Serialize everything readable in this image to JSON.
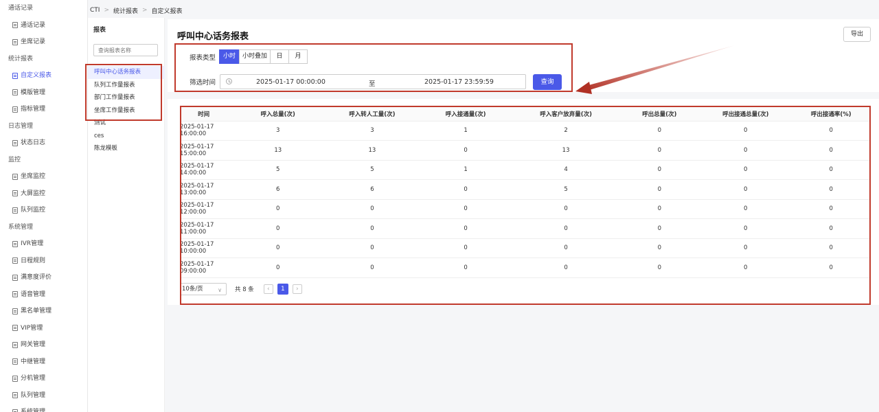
{
  "breadcrumb": [
    "CTI",
    "统计报表",
    "自定义报表"
  ],
  "sidebar": [
    {
      "type": "group",
      "label": "通话记录"
    },
    {
      "type": "item",
      "label": "通话记录"
    },
    {
      "type": "item",
      "label": "坐席记录"
    },
    {
      "type": "group",
      "label": "统计报表"
    },
    {
      "type": "item",
      "label": "自定义报表",
      "active": true
    },
    {
      "type": "item",
      "label": "模版管理"
    },
    {
      "type": "item",
      "label": "指标管理"
    },
    {
      "type": "group",
      "label": "日志管理"
    },
    {
      "type": "item",
      "label": "状态日志"
    },
    {
      "type": "group",
      "label": "监控"
    },
    {
      "type": "item",
      "label": "坐席监控"
    },
    {
      "type": "item",
      "label": "大屏监控"
    },
    {
      "type": "item",
      "label": "队列监控"
    },
    {
      "type": "group",
      "label": "系统管理"
    },
    {
      "type": "item",
      "label": "IVR管理"
    },
    {
      "type": "item",
      "label": "日程规则"
    },
    {
      "type": "item",
      "label": "满意度评价"
    },
    {
      "type": "item",
      "label": "语音管理"
    },
    {
      "type": "item",
      "label": "黑名单管理"
    },
    {
      "type": "item",
      "label": "VIP管理"
    },
    {
      "type": "item",
      "label": "网关管理"
    },
    {
      "type": "item",
      "label": "中继管理"
    },
    {
      "type": "item",
      "label": "分机管理"
    },
    {
      "type": "item",
      "label": "队列管理"
    },
    {
      "type": "item",
      "label": "系统管理"
    }
  ],
  "reports_panel": {
    "title": "报表",
    "search_placeholder": "查询报表名称",
    "items": [
      "呼叫中心话务报表",
      "队列工作量报表",
      "部门工作量报表",
      "坐席工作量报表",
      "测试",
      "ces",
      "陈龙模板"
    ],
    "active_index": 0
  },
  "main": {
    "title": "呼叫中心话务报表",
    "export_label": "导出",
    "filter": {
      "type_label": "报表类型",
      "types": [
        "小时",
        "小时叠加",
        "日",
        "月"
      ],
      "selected_type": "小时",
      "time_label": "筛选时间",
      "start": "2025-01-17 00:00:00",
      "to": "至",
      "end": "2025-01-17 23:59:59",
      "query_label": "查询"
    },
    "table": {
      "columns": [
        "时间",
        "呼入总量(次)",
        "呼入转人工量(次)",
        "呼入接通量(次)",
        "呼入客户放弃量(次)",
        "呼出总量(次)",
        "呼出接通总量(次)",
        "呼出接通率(%)"
      ],
      "rows": [
        [
          "2025-01-17 16:00:00",
          "3",
          "3",
          "1",
          "2",
          "0",
          "0",
          "0"
        ],
        [
          "2025-01-17 15:00:00",
          "13",
          "13",
          "0",
          "13",
          "0",
          "0",
          "0"
        ],
        [
          "2025-01-17 14:00:00",
          "5",
          "5",
          "1",
          "4",
          "0",
          "0",
          "0"
        ],
        [
          "2025-01-17 13:00:00",
          "6",
          "6",
          "0",
          "5",
          "0",
          "0",
          "0"
        ],
        [
          "2025-01-17 12:00:00",
          "0",
          "0",
          "0",
          "0",
          "0",
          "0",
          "0"
        ],
        [
          "2025-01-17 11:00:00",
          "0",
          "0",
          "0",
          "0",
          "0",
          "0",
          "0"
        ],
        [
          "2025-01-17 10:00:00",
          "0",
          "0",
          "0",
          "0",
          "0",
          "0",
          "0"
        ],
        [
          "2025-01-17 09:00:00",
          "0",
          "0",
          "0",
          "0",
          "0",
          "0",
          "0"
        ]
      ]
    },
    "pager": {
      "page_size": "10条/页",
      "total": "共 8 条",
      "current_page": "1",
      "prev": "‹",
      "next": "›",
      "chevron": "∨"
    }
  },
  "colors": {
    "accent": "#4a59e8",
    "annotation_red": "#c0392b"
  }
}
